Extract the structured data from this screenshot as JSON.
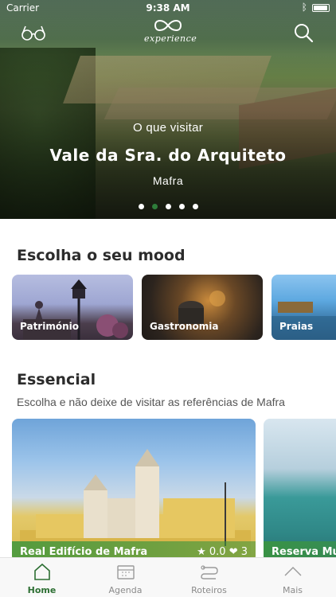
{
  "status_bar": {
    "carrier": "Carrier",
    "time": "9:38 AM"
  },
  "header": {
    "logo_text": "experience"
  },
  "hero": {
    "subtitle": "O que visitar",
    "title": "Vale da Sra. do Arquiteto",
    "location": "Mafra",
    "slides_total": 5,
    "active_slide": 2
  },
  "mood": {
    "title": "Escolha o seu mood",
    "items": [
      {
        "label": "Património"
      },
      {
        "label": "Gastronomia"
      },
      {
        "label": "Praias"
      }
    ]
  },
  "essencial": {
    "title": "Essencial",
    "subtitle": "Escolha e não deixe de visitar as referências de Mafra",
    "cards": [
      {
        "name": "Real Edifício de Mafra",
        "rating": "★ 0.0",
        "likes": "❤ 3"
      },
      {
        "name": "Reserva Mu"
      }
    ]
  },
  "tabbar": {
    "tabs": [
      {
        "label": "Home",
        "active": true
      },
      {
        "label": "Agenda",
        "active": false
      },
      {
        "label": "Roteiros",
        "active": false
      },
      {
        "label": "Mais",
        "active": false
      }
    ]
  },
  "colors": {
    "accent": "#2d6f33",
    "active_dot": "#2e7d3a",
    "title": "#2c2c2c"
  }
}
